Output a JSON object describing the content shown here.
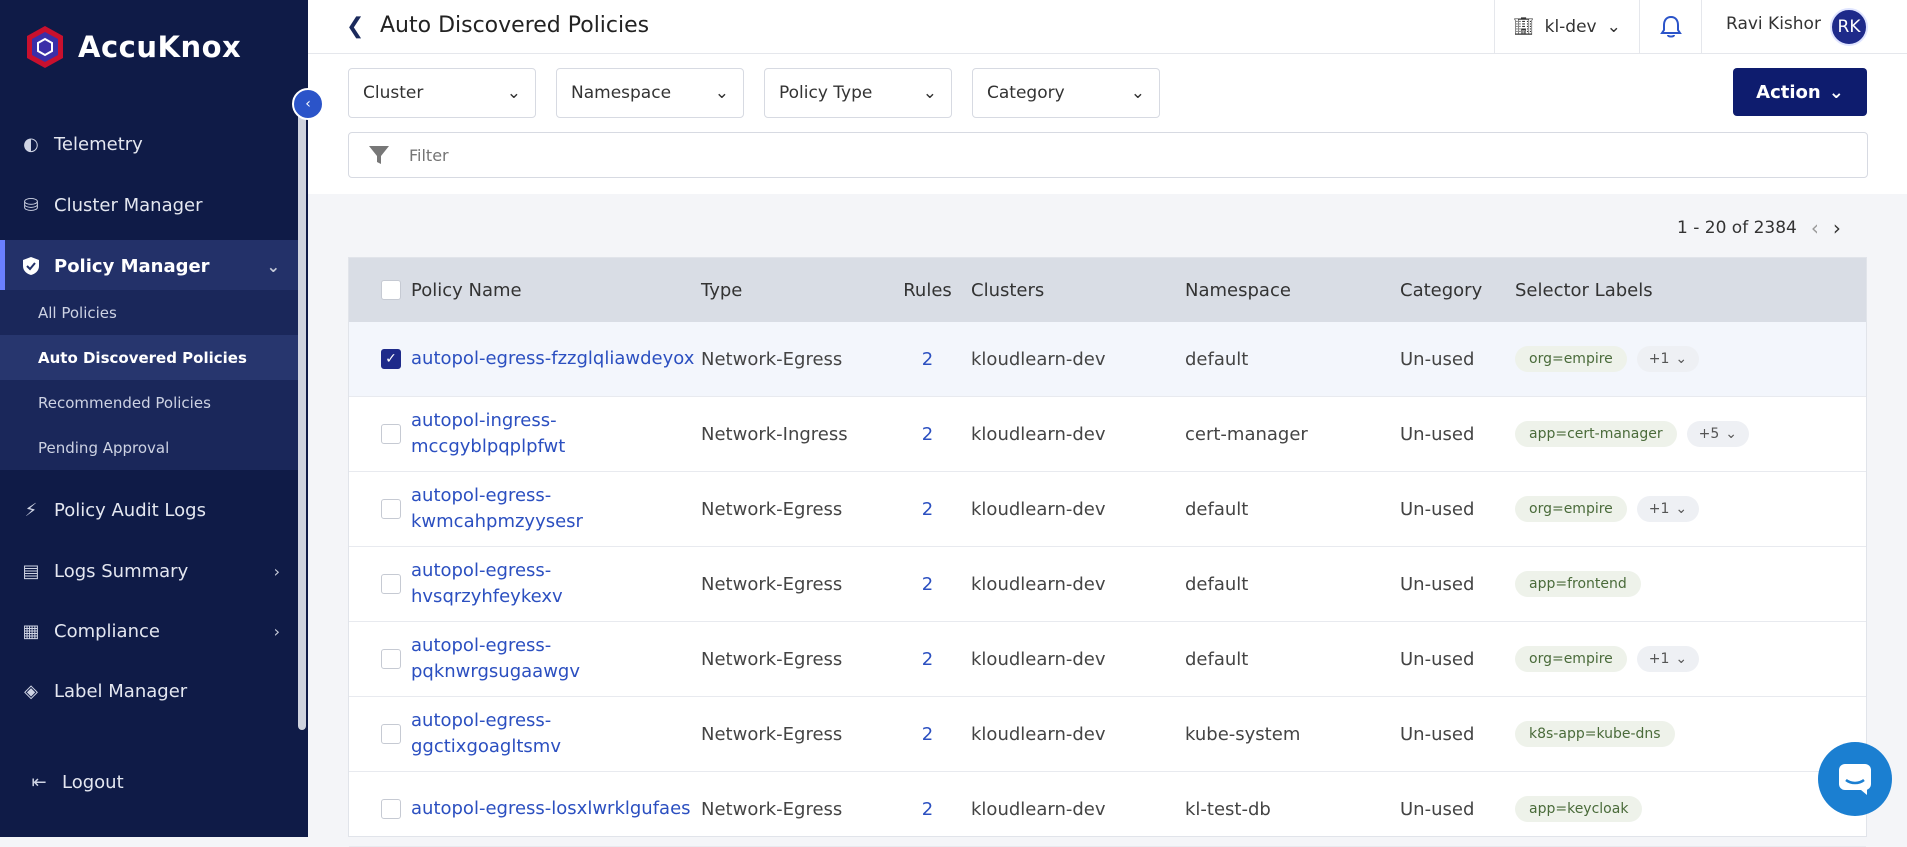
{
  "app": {
    "logo_text": "AccuKnox"
  },
  "sidebar": {
    "items": [
      {
        "label": "Telemetry",
        "icon": "telemetry-icon"
      },
      {
        "label": "Cluster Manager",
        "icon": "cluster-icon"
      },
      {
        "label": "Policy Manager",
        "icon": "shield-icon"
      },
      {
        "label": "Policy Audit Logs",
        "icon": "bolt-icon"
      },
      {
        "label": "Logs Summary",
        "icon": "logs-icon"
      },
      {
        "label": "Compliance",
        "icon": "compliance-icon"
      },
      {
        "label": "Label Manager",
        "icon": "label-icon"
      },
      {
        "label": "Logout",
        "icon": "logout-icon"
      }
    ],
    "submenu": [
      {
        "label": "All Policies"
      },
      {
        "label": "Auto Discovered Policies"
      },
      {
        "label": "Recommended Policies"
      },
      {
        "label": "Pending Approval"
      }
    ]
  },
  "header": {
    "title": "Auto Discovered Policies",
    "workspace": "kl-dev",
    "user_name": "Ravi Kishor",
    "user_initials": "RK"
  },
  "toolbar": {
    "filters": [
      "Cluster",
      "Namespace",
      "Policy Type",
      "Category"
    ],
    "action_label": "Action",
    "filter_placeholder": "Filter"
  },
  "pagination": {
    "text": "1 - 20 of 2384"
  },
  "table": {
    "columns": [
      "Policy Name",
      "Type",
      "Rules",
      "Clusters",
      "Namespace",
      "Category",
      "Selector Labels"
    ],
    "rows": [
      {
        "name": "autopol-egress-fzzglqliawdeyox",
        "type": "Network-Egress",
        "rules": "2",
        "cluster": "kloudlearn-dev",
        "namespace": "default",
        "category": "Un-used",
        "label": "org=empire",
        "more": "+1",
        "checked": true
      },
      {
        "name": "autopol-ingress-mccgyblpqplpfwt",
        "type": "Network-Ingress",
        "rules": "2",
        "cluster": "kloudlearn-dev",
        "namespace": "cert-manager",
        "category": "Un-used",
        "label": "app=cert-manager",
        "more": "+5",
        "checked": false
      },
      {
        "name": "autopol-egress-kwmcahpmzyysesr",
        "type": "Network-Egress",
        "rules": "2",
        "cluster": "kloudlearn-dev",
        "namespace": "default",
        "category": "Un-used",
        "label": "org=empire",
        "more": "+1",
        "checked": false
      },
      {
        "name": "autopol-egress-hvsqrzyhfeykexv",
        "type": "Network-Egress",
        "rules": "2",
        "cluster": "kloudlearn-dev",
        "namespace": "default",
        "category": "Un-used",
        "label": "app=frontend",
        "more": "",
        "checked": false
      },
      {
        "name": "autopol-egress-pqknwrgsugaawgv",
        "type": "Network-Egress",
        "rules": "2",
        "cluster": "kloudlearn-dev",
        "namespace": "default",
        "category": "Un-used",
        "label": "org=empire",
        "more": "+1",
        "checked": false
      },
      {
        "name": "autopol-egress-ggctixgoagltsmv",
        "type": "Network-Egress",
        "rules": "2",
        "cluster": "kloudlearn-dev",
        "namespace": "kube-system",
        "category": "Un-used",
        "label": "k8s-app=kube-dns",
        "more": "",
        "checked": false
      },
      {
        "name": "autopol-egress-losxlwrklgufaes",
        "type": "Network-Egress",
        "rules": "2",
        "cluster": "kloudlearn-dev",
        "namespace": "kl-test-db",
        "category": "Un-used",
        "label": "app=keycloak",
        "more": "",
        "checked": false
      }
    ]
  }
}
